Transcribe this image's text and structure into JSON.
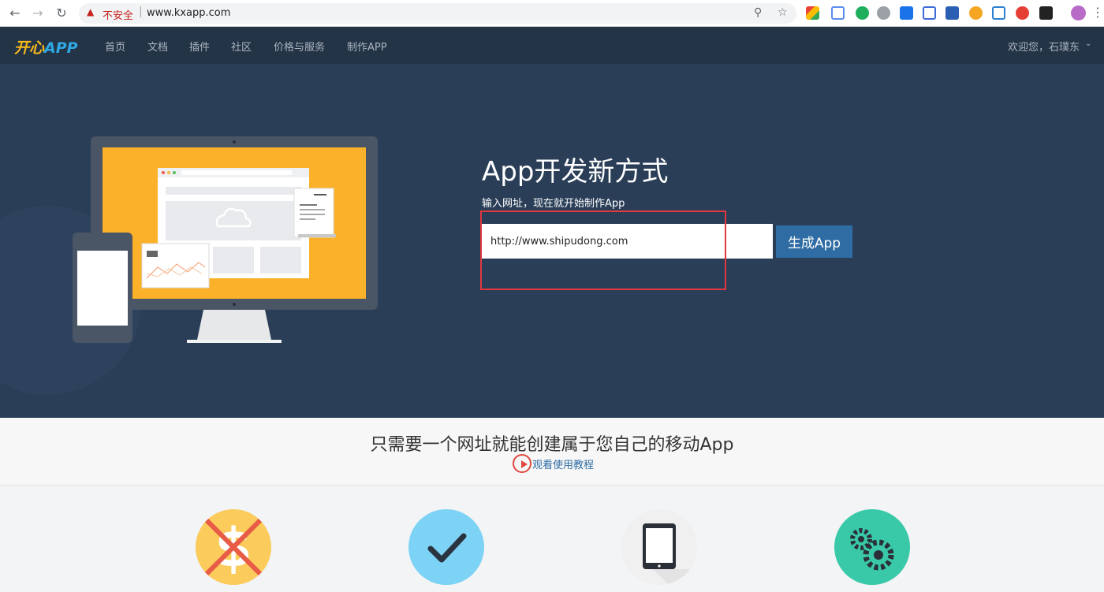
{
  "browser": {
    "back_icon": "arrow-left-icon",
    "forward_icon": "arrow-right-icon",
    "reload_icon": "reload-icon",
    "security_label": "不安全",
    "url": "www.kxapp.com",
    "key_icon": "key-icon",
    "star_icon": "star-icon"
  },
  "site": {
    "logo_part1": "开心",
    "logo_part2": "APP",
    "nav": [
      "首页",
      "文档",
      "插件",
      "社区",
      "价格与服务",
      "制作APP"
    ],
    "welcome": "欢迎您，石璞东"
  },
  "hero": {
    "title": "App开发新方式",
    "subtitle": "输入网址，现在就开始制作App",
    "input_value": "http://www.shipudong.com",
    "button_label": "生成App"
  },
  "band": {
    "title": "只需要一个网址就能创建属于您自己的移动App",
    "tutorial_label": "观看使用教程"
  },
  "features": [
    {
      "icon": "no-cost-icon",
      "color": "#fbcb5c"
    },
    {
      "icon": "checkmark-icon",
      "color": "#7dd3f5"
    },
    {
      "icon": "tablet-icon",
      "color": "#f0f0f0"
    },
    {
      "icon": "gears-icon",
      "color": "#3ac9a8"
    }
  ],
  "colors": {
    "nav_bg": "#243447",
    "hero_bg": "#2a3e58",
    "button_bg": "#2e6ca3",
    "highlight": "#e0383e",
    "monitor_screen": "#fbb22a"
  }
}
